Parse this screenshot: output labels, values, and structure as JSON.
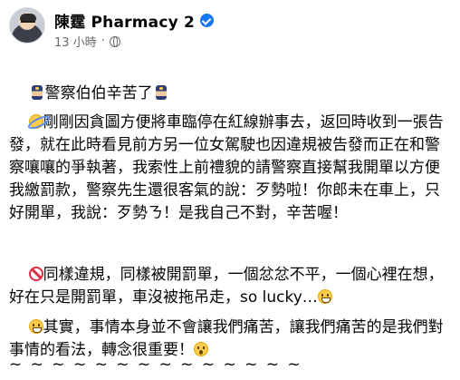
{
  "header": {
    "page_name": "陳霆 Pharmacy 2",
    "timestamp": "13 小時",
    "dot": "·",
    "audience_icon": "globe-icon",
    "verified_icon": "verified-icon"
  },
  "post": {
    "line1_text": "警察伯伯辛苦了",
    "line1_icons": [
      "police-officer-icon",
      "police-officer-icon"
    ],
    "para2_icon": "dizzy-face-icon",
    "para2_text": "剛剛因貪圖方便將車臨停在紅線辦事去，返回時收到一張告發，就在此時看見前方另一位女駕駛也因違規被告發而正在和警察嚷嚷的爭執著，我索性上前禮貌的請警察直接幫我開單以方便我繳罰款，警察先生還很客氣的說：歹勢啦！你郎未在車上，只好開單，我說：歹勢ㄋ！是我自己不對，辛苦喔！",
    "para3_icon": "prohibited-icon",
    "para3_text": "同樣違規，同樣被開罰單，一個忿忿不平，一個心裡在想，好在只是開罰單，車沒被拖吊走，so lucky…",
    "para3_end_icon": "grin-sweat-icon",
    "para4_icon": "grin-sweat-icon",
    "para4_text": "其實，事情本身並不會讓我們痛苦，讓我們痛苦的是我們對事情的看法，轉念很重要！",
    "para4_end_icon": "shocked-face-icon",
    "divider_text": "~ ~ ~ ~ ~ ~ ~ ~ ~ ~ ~ ~ ~ ~"
  },
  "colors": {
    "text": "#050505",
    "meta": "#65676b",
    "verified": "#1877f2"
  }
}
